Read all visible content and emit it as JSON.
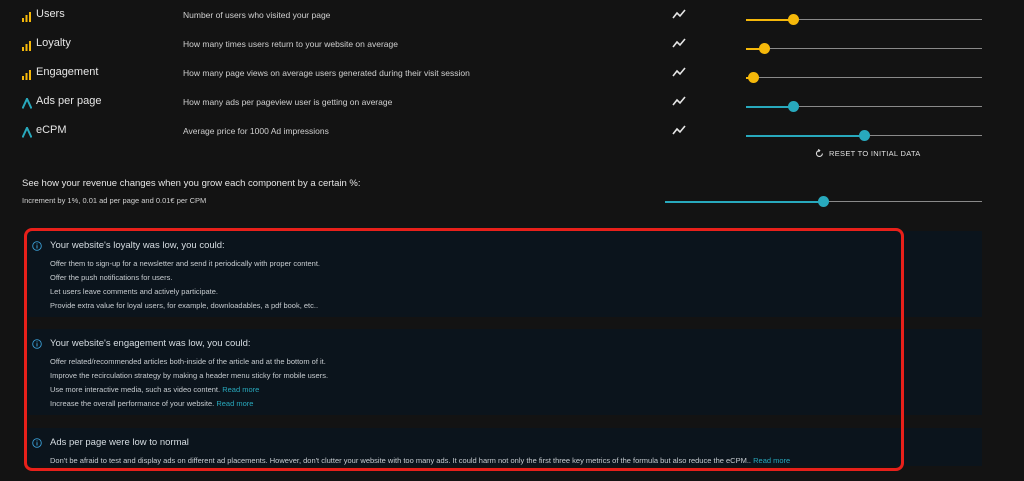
{
  "metrics": [
    {
      "name": "Users",
      "description": "Number of users who visited your page",
      "icon": "bar-chart-icon",
      "slider_value": 0.2
    },
    {
      "name": "Loyalty",
      "description": "How many times users return to your website on average",
      "icon": "bar-chart-icon",
      "slider_value": 0.08
    },
    {
      "name": "Engagement",
      "description": "How many page views on average users generated during their visit session",
      "icon": "bar-chart-icon",
      "slider_value": 0.03
    },
    {
      "name": "Ads per page",
      "description": "How many ads per pageview user is getting on average",
      "icon": "ad-logo-icon",
      "slider_value": 0.2
    },
    {
      "name": "eCPM",
      "description": "Average price for 1000 Ad impressions",
      "icon": "ad-logo-icon",
      "slider_value": 0.5
    }
  ],
  "reset_label": "RESET TO INITIAL DATA",
  "growth": {
    "title": "See how your revenue changes when you grow each component by a certain %:",
    "subtitle": "Increment by 1%, 0.01 ad per page and 0.01€ per CPM",
    "slider_value": 0.5
  },
  "tips": [
    {
      "title": "Your website's loyalty was low, you could:",
      "items": [
        {
          "text": "Offer them to sign-up for a newsletter and send it periodically with proper content.",
          "link": ""
        },
        {
          "text": "Offer the push notifications for users.",
          "link": ""
        },
        {
          "text": "Let users leave comments and actively participate.",
          "link": ""
        },
        {
          "text": "Provide extra value for loyal users, for example, downloadables, a pdf book, etc..",
          "link": ""
        }
      ]
    },
    {
      "title": "Your website's engagement was low, you could:",
      "items": [
        {
          "text": "Offer related/recommended articles both-inside of the article and at the bottom of it.",
          "link": ""
        },
        {
          "text": "Improve the recirculation strategy by making a header menu sticky for mobile users.",
          "link": ""
        },
        {
          "text": "Use more interactive media, such as video content.",
          "link": "Read more"
        },
        {
          "text": "Increase the overall performance of your website.",
          "link": "Read more"
        }
      ]
    },
    {
      "title": "Ads per page were low to normal",
      "items": [
        {
          "text": "Don't be afraid to test and display ads on different ad placements. However, don't clutter your website with too many ads. It could harm not only the first three key metrics of the formula but also reduce the eCPM..",
          "link": "Read more"
        }
      ]
    }
  ],
  "colors": {
    "accent_yellow": "#f5b80a",
    "accent_teal": "#28a9bd",
    "highlight_red": "#e8201a",
    "background": "#131313"
  }
}
